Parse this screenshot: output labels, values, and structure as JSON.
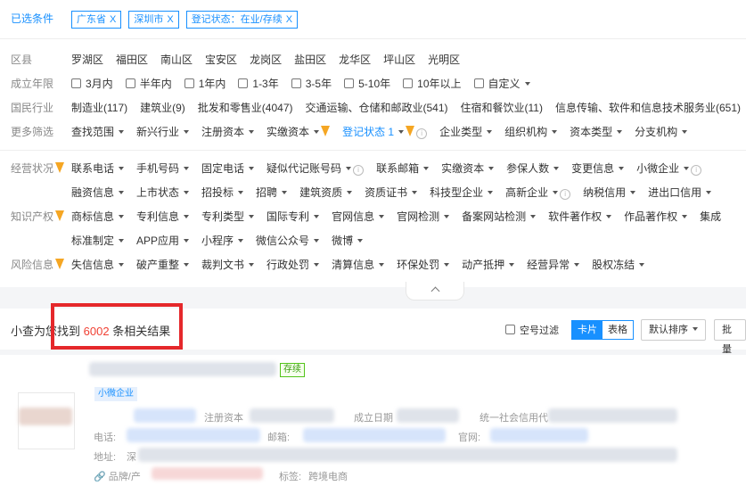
{
  "selected": {
    "label": "已选条件",
    "tags": [
      "广东省",
      "深圳市",
      "登记状态：在业/存续"
    ],
    "close": "X"
  },
  "district": {
    "label": "区县",
    "items": [
      "罗湖区",
      "福田区",
      "南山区",
      "宝安区",
      "龙岗区",
      "盐田区",
      "龙华区",
      "坪山区",
      "光明区"
    ]
  },
  "founded": {
    "label": "成立年限",
    "items": [
      "3月内",
      "半年内",
      "1年内",
      "1-3年",
      "3-5年",
      "5-10年",
      "10年以上",
      "自定义"
    ]
  },
  "industry": {
    "label": "国民行业",
    "items": [
      "制造业(117)",
      "建筑业(9)",
      "批发和零售业(4047)",
      "交通运输、仓储和邮政业(541)",
      "住宿和餐饮业(11)",
      "信息传输、软件和信息技术服务业(651)"
    ]
  },
  "more": {
    "label": "更多筛选",
    "items": [
      "查找范围",
      "新兴行业",
      "注册资本",
      "实缴资本",
      "登记状态 1",
      "企业类型",
      "组织机构",
      "资本类型",
      "分支机构"
    ]
  },
  "business": {
    "label": "经营状况",
    "row1": [
      "联系电话",
      "手机号码",
      "固定电话",
      "疑似代记账号码",
      "联系邮箱",
      "实缴资本",
      "参保人数",
      "变更信息",
      "小微企业"
    ],
    "row2": [
      "融资信息",
      "上市状态",
      "招投标",
      "招聘",
      "建筑资质",
      "资质证书",
      "科技型企业",
      "高新企业",
      "纳税信用",
      "进出口信用"
    ]
  },
  "ip": {
    "label": "知识产权",
    "row1": [
      "商标信息",
      "专利信息",
      "专利类型",
      "国际专利",
      "官网信息",
      "官网检测",
      "备案网站检测",
      "软件著作权",
      "作品著作权",
      "集成"
    ],
    "row2": [
      "标准制定",
      "APP应用",
      "小程序",
      "微信公众号",
      "微博"
    ]
  },
  "risk": {
    "label": "风险信息",
    "items": [
      "失信信息",
      "破产重整",
      "裁判文书",
      "行政处罚",
      "清算信息",
      "环保处罚",
      "动产抵押",
      "经营异常",
      "股权冻结"
    ]
  },
  "results": {
    "prefix": "小查为您找到",
    "count": "6002",
    "suffix": "条相关结果",
    "empty_filter": "空号过滤",
    "view_card": "卡片",
    "view_table": "表格",
    "sort": "默认排序",
    "batch": "批量"
  },
  "card": {
    "status": "存续",
    "type_tag": "小微企业",
    "reg_capital": "注册资本",
    "founded_date": "成立日期",
    "credit_code": "统一社会信用代",
    "phone": "电话:",
    "email": "邮箱:",
    "website": "官网:",
    "address": "地址:",
    "address_prefix": "深",
    "brand": "品牌/产",
    "tags_label": "标签:",
    "tag_value": "跨境电商"
  },
  "colors": {
    "accent": "#1890ff",
    "highlight": "#f04134",
    "box": "#e5282b"
  }
}
